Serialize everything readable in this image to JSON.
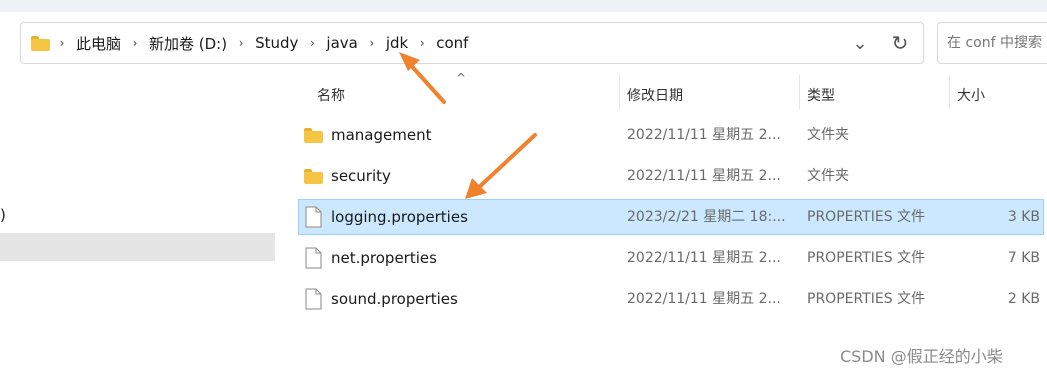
{
  "address": {
    "crumbs": [
      "此电脑",
      "新加卷 (D:)",
      "Study",
      "java",
      "jdk",
      "conf"
    ],
    "separator": "›"
  },
  "search": {
    "placeholder": "在 conf 中搜索"
  },
  "nav": {
    "fragment": ")"
  },
  "columns": {
    "name": "名称",
    "modified": "修改日期",
    "type": "类型",
    "size": "大小"
  },
  "files": [
    {
      "name": "management",
      "modified": "2022/11/11 星期五 2...",
      "type": "文件夹",
      "size": "",
      "kind": "folder",
      "selected": false
    },
    {
      "name": "security",
      "modified": "2022/11/11 星期五 2...",
      "type": "文件夹",
      "size": "",
      "kind": "folder",
      "selected": false
    },
    {
      "name": "logging.properties",
      "modified": "2023/2/21 星期二 18:...",
      "type": "PROPERTIES 文件",
      "size": "3 KB",
      "kind": "file",
      "selected": true
    },
    {
      "name": "net.properties",
      "modified": "2022/11/11 星期五 2...",
      "type": "PROPERTIES 文件",
      "size": "7 KB",
      "kind": "file",
      "selected": false
    },
    {
      "name": "sound.properties",
      "modified": "2022/11/11 星期五 2...",
      "type": "PROPERTIES 文件",
      "size": "2 KB",
      "kind": "file",
      "selected": false
    }
  ],
  "watermark": "CSDN @假正经的小柴",
  "colors": {
    "selection": "#cce8ff",
    "selection_border": "#99d1ff",
    "arrow": "#f0822e",
    "folder": "#f6c544"
  }
}
